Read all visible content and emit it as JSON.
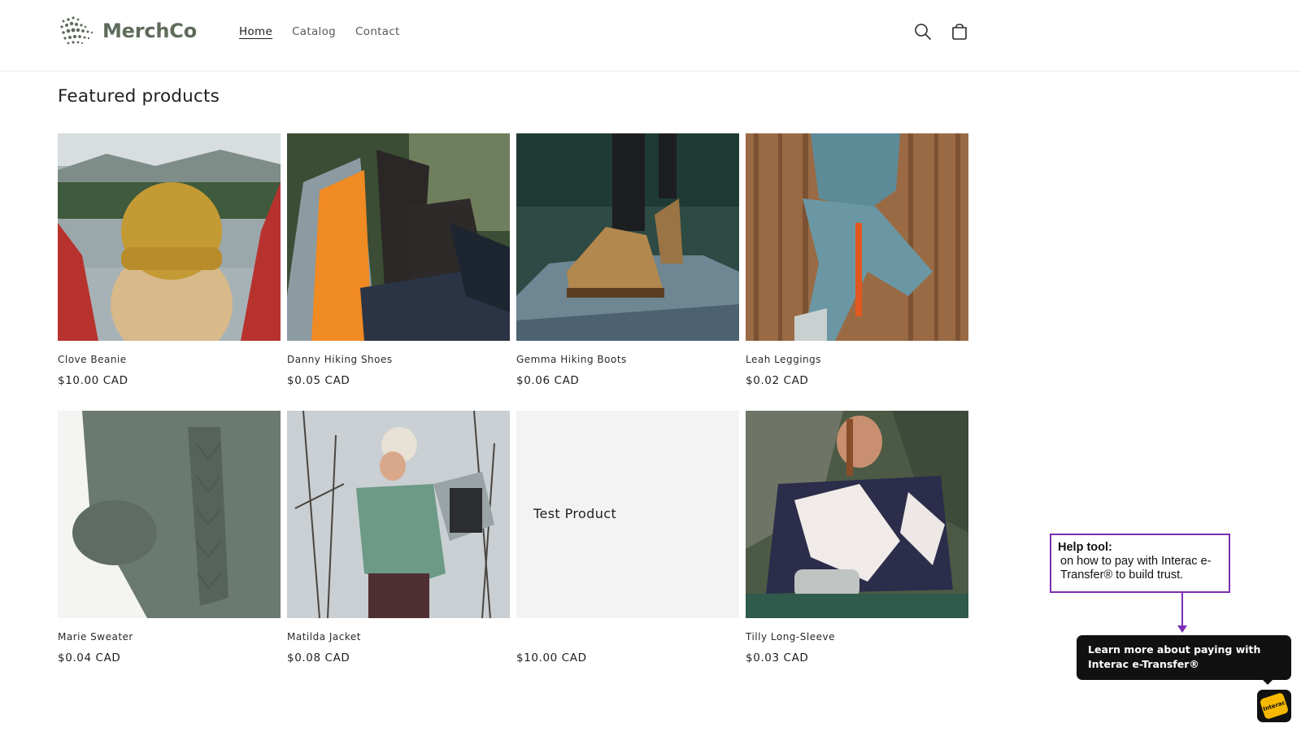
{
  "header": {
    "logo_text": "MerchCo",
    "nav": [
      {
        "label": "Home",
        "active": true
      },
      {
        "label": "Catalog",
        "active": false
      },
      {
        "label": "Contact",
        "active": false
      }
    ],
    "icons": {
      "search": "search-icon",
      "cart": "cart-icon"
    }
  },
  "section": {
    "title": "Featured products"
  },
  "products": [
    {
      "name": "Clove Beanie",
      "price": "$10.00 CAD",
      "image": "woman-yellow-beanie-lake"
    },
    {
      "name": "Danny Hiking Shoes",
      "price": "$0.05 CAD",
      "image": "hiking-boots-hammock"
    },
    {
      "name": "Gemma Hiking Boots",
      "price": "$0.06 CAD",
      "image": "boots-on-rock"
    },
    {
      "name": "Leah Leggings",
      "price": "$0.02 CAD",
      "image": "blue-leggings-wood-wall"
    },
    {
      "name": "Marie Sweater",
      "price": "$0.04 CAD",
      "image": "green-knit-sweater"
    },
    {
      "name": "Matilda Jacket",
      "price": "$0.08 CAD",
      "image": "woman-green-jacket-snow"
    },
    {
      "name": "",
      "price": "$10.00 CAD",
      "placeholder_text": "Test Product"
    },
    {
      "name": "Tilly Long-Sleeve",
      "price": "$0.03 CAD",
      "image": "navy-white-long-sleeve"
    }
  ],
  "annotation": {
    "title": "Help tool:",
    "body": "on how to pay with Interac e-Transfer® to build trust.",
    "color": "#7b2fb5"
  },
  "interac_widget": {
    "tooltip": "Learn more about paying with Interac e-Transfer®",
    "badge_text": "Interac",
    "badge_color": "#f6b800"
  }
}
